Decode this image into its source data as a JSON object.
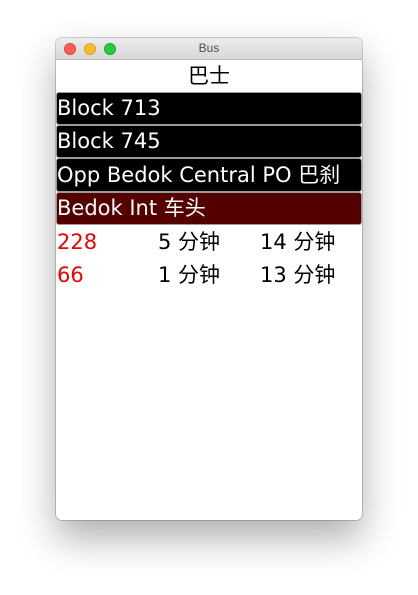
{
  "window": {
    "title": "Bus"
  },
  "header": {
    "title": "巴士"
  },
  "stops": [
    {
      "label": "Block 713",
      "selected": false
    },
    {
      "label": "Block 745",
      "selected": false
    },
    {
      "label": "Opp Bedok Central PO 巴刹",
      "selected": false
    },
    {
      "label": "Bedok Int 车头",
      "selected": true
    }
  ],
  "arrivals": [
    {
      "service": "228",
      "next": "5 分钟",
      "subsequent": "14 分钟"
    },
    {
      "service": "66",
      "next": "1 分钟",
      "subsequent": "13 分钟"
    }
  ],
  "colors": {
    "stop_bg": "#000000",
    "selected_stop_bg": "#550000",
    "service_text": "#ee0000"
  },
  "icons": {
    "close": "close-icon",
    "minimize": "minimize-icon",
    "maximize": "maximize-icon"
  }
}
